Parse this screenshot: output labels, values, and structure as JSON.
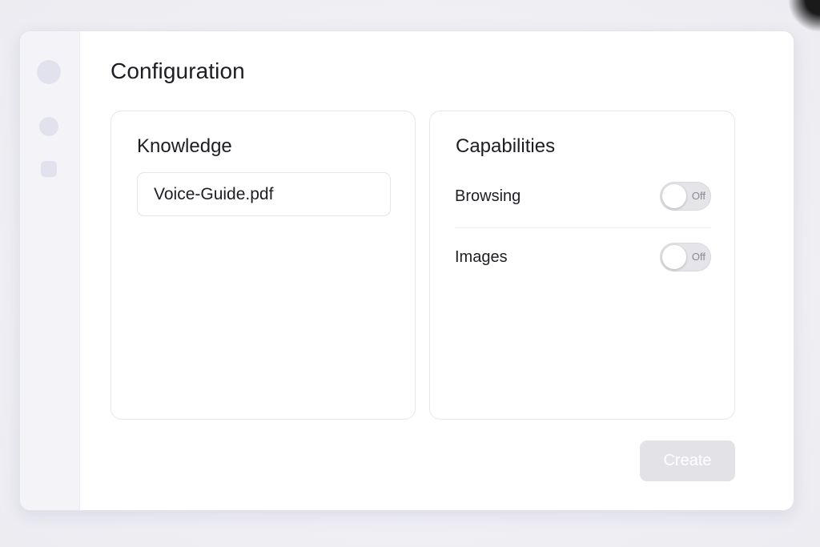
{
  "page": {
    "title": "Configuration"
  },
  "knowledge": {
    "title": "Knowledge",
    "file_name": "Voice-Guide.pdf"
  },
  "capabilities": {
    "title": "Capabilities",
    "items": [
      {
        "label": "Browsing",
        "toggle_state": "Off",
        "enabled": false
      },
      {
        "label": "Images",
        "toggle_state": "Off",
        "enabled": false
      }
    ]
  },
  "actions": {
    "create_label": "Create",
    "create_disabled": true
  },
  "colors": {
    "window_background": "#ffffff",
    "rail_background": "#f4f4f8",
    "toggle_off": "#e4e4e9",
    "button_disabled": "#e3e3e7"
  }
}
